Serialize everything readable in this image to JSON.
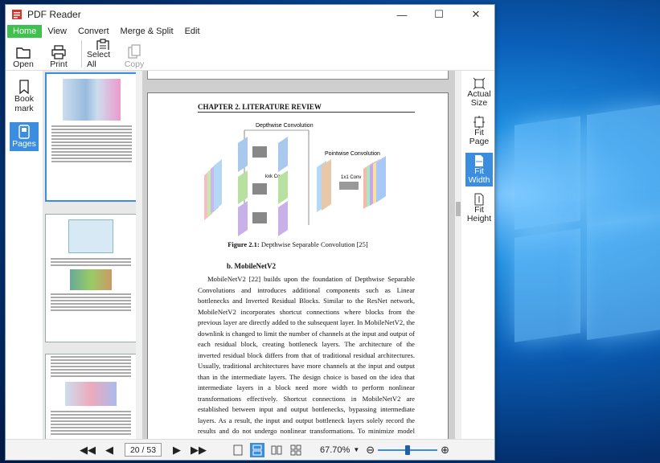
{
  "window": {
    "title": "PDF Reader"
  },
  "menu": [
    "Home",
    "View",
    "Convert",
    "Merge & Split",
    "Edit"
  ],
  "ribbon": {
    "open": "Open",
    "print": "Print",
    "select_all": "Select All",
    "copy": "Copy"
  },
  "leftnav": {
    "bookmark": "Book mark",
    "pages": "Pages"
  },
  "rightnav": {
    "actual_size": "Actual Size",
    "fit_page": "Fit Page",
    "fit_width": "Fit Width",
    "fit_height": "Fit Height"
  },
  "status": {
    "page_indicator": "20 / 53",
    "zoom": "67.70%"
  },
  "document": {
    "chapter_header": "CHAPTER 2.  LITERATURE REVIEW",
    "fig_labels": {
      "depthwise": "Depthwise Convolution",
      "pointwise": "Pointwise Convolution",
      "kxk": "kxk Conv",
      "onexone": "1x1 Conv"
    },
    "caption_bold": "Figure 2.1:",
    "caption_text": " Depthwise Separable Convolution [25]",
    "section": "b.   MobileNetV2",
    "paragraph": "MobileNetV2 [22] builds upon the foundation of Depthwise Separable Convolutions and introduces additional components such as Linear bottlenecks and Inverted Residual Blocks. Similar to the ResNet network, MobileNetV2 incorporates shortcut connections where blocks from the previous layer are directly added to the subsequent layer. In MobileNetV2, the downlink is changed to limit the number of channels at the input and output of each residual block, creating bottleneck layers. The architecture of the inverted residual block differs from that of traditional residual architectures. Usually, traditional architectures have more channels at the input and output than in the intermediate layers. The design choice is based on the idea that intermediate layers in a block need more width to perform nonlinear transformations effectively. Shortcut connections in MobileNetV2 are established between input and output bottlenecks, bypassing intermediate layers. As a result, the input and output bottleneck layers solely record the results and do not undergo nonlinear transformations. To minimize model parameters, depth-separated convolution transforms are employed between layers within an inverted residual block. This contributes to the reduction in the size of MobileNet models. The authors of the original paper say that using ReLU and Sigmoid activations in the residual block"
  },
  "colors": {
    "accent": "#3b8de0",
    "menu_active": "#3ec24d"
  }
}
